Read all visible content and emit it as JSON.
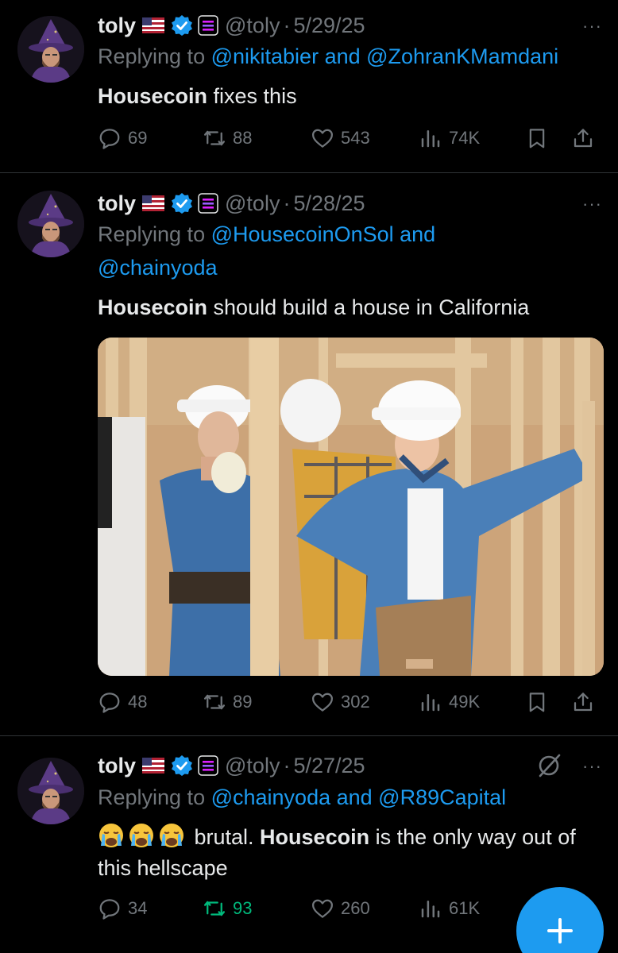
{
  "tweets": [
    {
      "name": "toly",
      "handle": "@toly",
      "date": "5/29/25",
      "reply_prefix": "Replying to ",
      "reply_link1": "@nikitabier",
      "reply_and": " and ",
      "reply_link2": "@ZohranKMamdani",
      "body_bold": "Housecoin",
      "body_rest": " fixes this",
      "replies": "69",
      "retweets": "88",
      "likes": "543",
      "views": "74K"
    },
    {
      "name": "toly",
      "handle": "@toly",
      "date": "5/28/25",
      "reply_prefix": "Replying to ",
      "reply_link1": "@HousecoinOnSol",
      "reply_and": " and ",
      "reply_link2": "@chainyoda",
      "body_bold": "Housecoin",
      "body_rest": " should build a house in California",
      "replies": "48",
      "retweets": "89",
      "likes": "302",
      "views": "49K"
    },
    {
      "name": "toly",
      "handle": "@toly",
      "date": "5/27/25",
      "reply_prefix": "Replying to ",
      "reply_link1": "@chainyoda",
      "reply_and": " and ",
      "reply_link2": "@R89Capital",
      "body_pre": " brutal. ",
      "body_bold": "Housecoin",
      "body_rest": " is the only way out of this hellscape",
      "replies": "34",
      "retweets": "93",
      "likes": "260",
      "views": "61K"
    }
  ],
  "more_label": "···",
  "dot": "·",
  "colors": {
    "background": "#000000",
    "text": "#e7e9ea",
    "muted": "#71767b",
    "link": "#1d9bf0",
    "retweeted": "#00ba7c",
    "divider": "#2f3336"
  },
  "icons": [
    "reply-icon",
    "retweet-icon",
    "like-icon",
    "views-icon",
    "bookmark-icon",
    "share-icon",
    "verified-icon",
    "us-flag-icon",
    "affiliate-badge-icon",
    "grok-icon",
    "compose-plus-icon",
    "crying-emoji-icon"
  ]
}
